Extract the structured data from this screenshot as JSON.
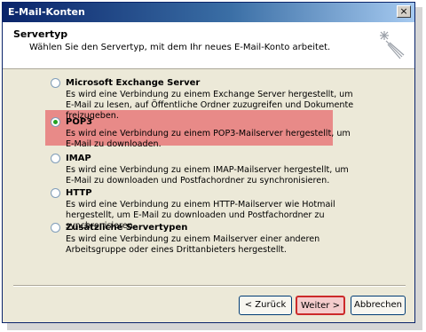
{
  "window": {
    "title": "E-Mail-Konten",
    "close_label": "×"
  },
  "header": {
    "title": "Servertyp",
    "subtitle": "Wählen Sie den Servertyp, mit dem Ihr neues E-Mail-Konto arbeitet."
  },
  "options": [
    {
      "label": "Microsoft Exchange Server",
      "selected": false,
      "desc": "Es wird eine Verbindung zu einem Exchange Server hergestellt, um E-Mail zu lesen, auf Öffentliche Ordner zuzugreifen und Dokumente freizugeben."
    },
    {
      "label": "POP3",
      "selected": true,
      "desc": "Es wird eine Verbindung zu einem POP3-Mailserver hergestellt, um E-Mail zu downloaden."
    },
    {
      "label": "IMAP",
      "selected": false,
      "desc": "Es wird eine Verbindung zu einem IMAP-Mailserver hergestellt, um E-Mail zu downloaden und Postfachordner zu synchronisieren."
    },
    {
      "label": "HTTP",
      "selected": false,
      "desc": "Es wird eine Verbindung zu einem HTTP-Mailserver wie Hotmail hergestellt, um E-Mail zu downloaden und Postfachordner zu synchronisieren."
    },
    {
      "label": "Zusätzliche Servertypen",
      "selected": false,
      "desc": "Es wird eine Verbindung zu einem Mailserver einer anderen Arbeitsgruppe oder eines Drittanbieters hergestellt."
    }
  ],
  "buttons": {
    "back": "< Zurück",
    "next": "Weiter >",
    "cancel": "Abbrechen"
  },
  "colors": {
    "highlight": "#e88080",
    "title_bar": "#0a246a",
    "dialog_bg": "#ece9d8"
  }
}
